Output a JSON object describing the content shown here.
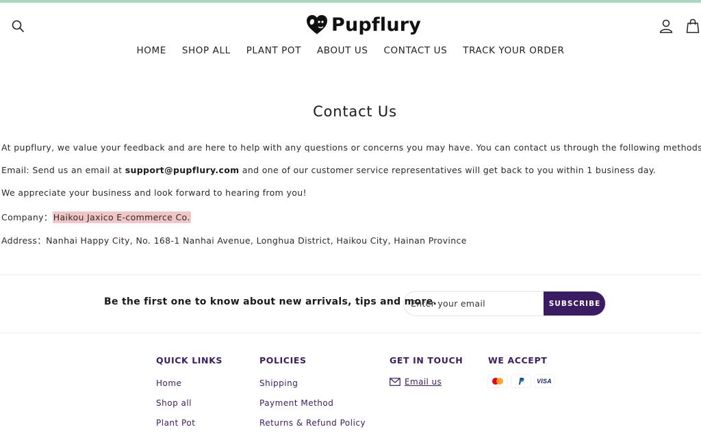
{
  "brand": {
    "name": "Pupflury"
  },
  "header": {
    "nav": [
      "HOME",
      "SHOP ALL",
      "PLANT POT",
      "ABOUT US",
      "CONTACT US",
      "TRACK YOUR ORDER"
    ]
  },
  "page": {
    "title": "Contact Us",
    "intro": "At pupflury, we value your feedback and are here to help with any questions or concerns you may have. You can contact us through the following methods:",
    "email_prefix": "Email: Send us an email at ",
    "email_address": "support@pupflury.com",
    "email_suffix": " and one of our customer service representatives will get back to you within 1 business day.",
    "appreciate": "We appreciate your business and look forward to hearing from you!",
    "company_label": "Company：",
    "company_value": "Haikou Jaxico E-commerce Co.",
    "address_label": "Address：",
    "address_value": "Nanhai Happy City, No. 168-1 Nanhai Avenue, Longhua District, Haikou City, Hainan Province"
  },
  "newsletter": {
    "text": "Be the first one to know about new arrivals, tips and more.",
    "placeholder": "Enter your email",
    "button": "SUBSCRIBE"
  },
  "footer": {
    "quick_links": {
      "heading": "QUICK LINKS",
      "items": [
        "Home",
        "Shop all",
        "Plant Pot"
      ]
    },
    "policies": {
      "heading": "POLICIES",
      "items": [
        "Shipping",
        "Payment Method",
        "Returns & Refund Policy"
      ]
    },
    "get_in_touch": {
      "heading": "GET IN TOUCH",
      "email_label": "Email us"
    },
    "we_accept": {
      "heading": "WE ACCEPT",
      "cards": [
        "mastercard-icon",
        "paypal-icon",
        "visa-icon"
      ],
      "visa_text": "VISA"
    }
  },
  "colors": {
    "accent": "#3b1b63",
    "topbar": "#a8d8bd",
    "highlight": "#f3c6c6"
  }
}
